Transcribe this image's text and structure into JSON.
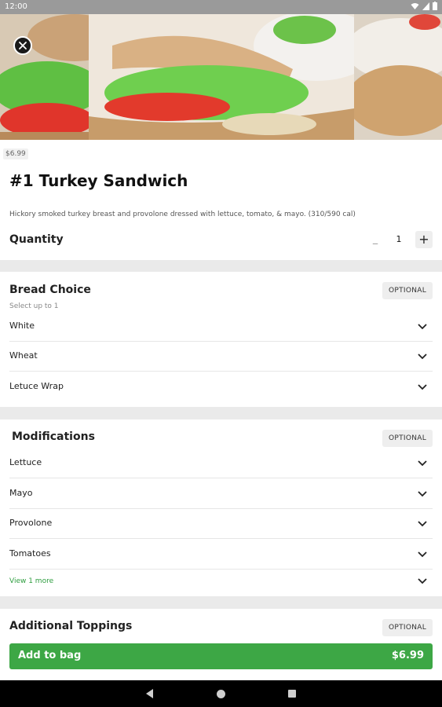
{
  "status_bar": {
    "time": "12:00"
  },
  "item": {
    "price_chip": "$6.99",
    "title": "#1 Turkey Sandwich",
    "description": "Hickory smoked turkey breast and provolone dressed with lettuce, tomato, & mayo. (310/590 cal)"
  },
  "quantity": {
    "label": "Quantity",
    "value": "1",
    "minus": "–",
    "plus": "+"
  },
  "bread": {
    "title": "Bread Choice",
    "badge": "OPTIONAL",
    "subtitle": "Select up to 1",
    "options": [
      "White",
      "Wheat",
      "Letuce Wrap"
    ]
  },
  "modifications": {
    "title": "Modifications",
    "badge": "OPTIONAL",
    "options": [
      "Lettuce",
      "Mayo",
      "Provolone",
      "Tomatoes"
    ],
    "view_more": "View 1 more"
  },
  "toppings": {
    "title": "Additional Toppings",
    "badge": "OPTIONAL"
  },
  "cta": {
    "label": "Add to bag",
    "price": "$6.99"
  },
  "icons": [
    "close-icon",
    "chevron-down-icon",
    "back-icon",
    "home-icon",
    "recents-icon",
    "wifi-icon",
    "battery-icon"
  ],
  "colors": {
    "accent_green": "#3da745",
    "link_green": "#2e9d3f",
    "divider": "#eaeaea"
  }
}
